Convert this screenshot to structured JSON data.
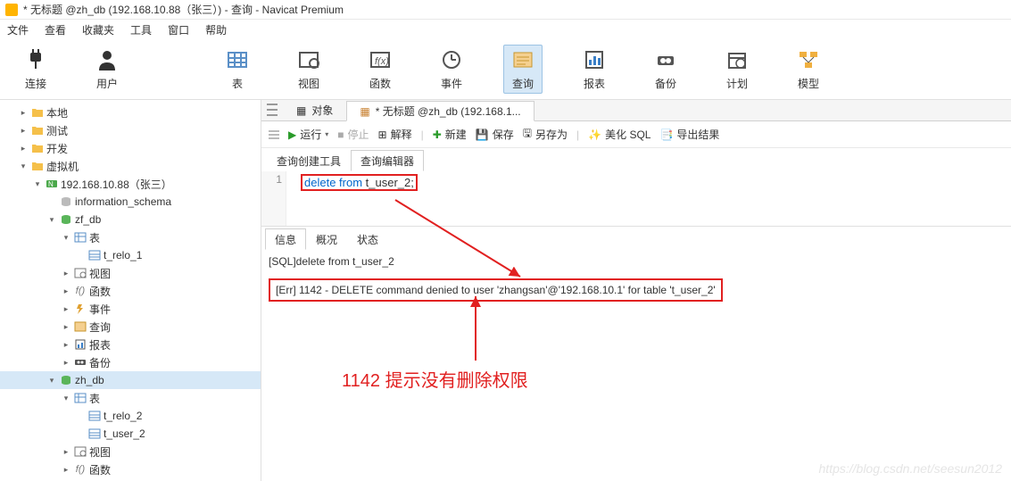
{
  "titlebar": {
    "text": "* 无标题 @zh_db (192.168.10.88（张三）) - 查询 - Navicat Premium"
  },
  "menubar": [
    "文件",
    "查看",
    "收藏夹",
    "工具",
    "窗口",
    "帮助"
  ],
  "toolbar": [
    {
      "label": "连接",
      "icon": "plug"
    },
    {
      "label": "用户",
      "icon": "user"
    },
    {
      "label": "表",
      "icon": "table"
    },
    {
      "label": "视图",
      "icon": "view"
    },
    {
      "label": "函数",
      "icon": "fx"
    },
    {
      "label": "事件",
      "icon": "event"
    },
    {
      "label": "查询",
      "icon": "query",
      "active": true
    },
    {
      "label": "报表",
      "icon": "report"
    },
    {
      "label": "备份",
      "icon": "backup"
    },
    {
      "label": "计划",
      "icon": "schedule"
    },
    {
      "label": "模型",
      "icon": "model"
    }
  ],
  "tree": [
    {
      "lvl": 0,
      "exp": ">",
      "icon": "folder",
      "label": "本地"
    },
    {
      "lvl": 0,
      "exp": ">",
      "icon": "folder",
      "label": "测试"
    },
    {
      "lvl": 0,
      "exp": ">",
      "icon": "folder",
      "label": "开发"
    },
    {
      "lvl": 0,
      "exp": "v",
      "icon": "folder",
      "label": "虚拟机"
    },
    {
      "lvl": 1,
      "exp": "v",
      "icon": "conn",
      "label": "192.168.10.88（张三）"
    },
    {
      "lvl": 2,
      "exp": "",
      "icon": "db-off",
      "label": "information_schema"
    },
    {
      "lvl": 2,
      "exp": "v",
      "icon": "db",
      "label": "zf_db"
    },
    {
      "lvl": 3,
      "exp": "v",
      "icon": "tables",
      "label": "表"
    },
    {
      "lvl": 4,
      "exp": "",
      "icon": "table",
      "label": "t_relo_1"
    },
    {
      "lvl": 3,
      "exp": ">",
      "icon": "view",
      "label": "视图"
    },
    {
      "lvl": 3,
      "exp": ">",
      "icon": "fx",
      "label": "函数"
    },
    {
      "lvl": 3,
      "exp": ">",
      "icon": "event",
      "label": "事件"
    },
    {
      "lvl": 3,
      "exp": ">",
      "icon": "query",
      "label": "查询"
    },
    {
      "lvl": 3,
      "exp": ">",
      "icon": "report",
      "label": "报表"
    },
    {
      "lvl": 3,
      "exp": ">",
      "icon": "backup",
      "label": "备份"
    },
    {
      "lvl": 2,
      "exp": "v",
      "icon": "db",
      "label": "zh_db",
      "selected": true
    },
    {
      "lvl": 3,
      "exp": "v",
      "icon": "tables",
      "label": "表"
    },
    {
      "lvl": 4,
      "exp": "",
      "icon": "table",
      "label": "t_relo_2"
    },
    {
      "lvl": 4,
      "exp": "",
      "icon": "table",
      "label": "t_user_2"
    },
    {
      "lvl": 3,
      "exp": ">",
      "icon": "view",
      "label": "视图"
    },
    {
      "lvl": 3,
      "exp": ">",
      "icon": "fx",
      "label": "函数"
    }
  ],
  "tabs": [
    {
      "label": "对象",
      "icon": "obj"
    },
    {
      "label": "* 无标题 @zh_db (192.168.1...",
      "icon": "query",
      "active": true
    }
  ],
  "actions": {
    "run": "运行",
    "stop": "停止",
    "explain": "解释",
    "new": "新建",
    "save": "保存",
    "saveas": "另存为",
    "beautify": "美化 SQL",
    "export": "导出结果"
  },
  "innertabs": [
    {
      "label": "查询创建工具"
    },
    {
      "label": "查询编辑器",
      "active": true
    }
  ],
  "editor": {
    "lineno": "1",
    "code_kw1": "delete",
    "code_kw2": "from",
    "code_rest": " t_user_2;"
  },
  "restabs": [
    {
      "label": "信息",
      "active": true
    },
    {
      "label": "概况"
    },
    {
      "label": "状态"
    }
  ],
  "results": {
    "line1": "[SQL]delete from t_user_2",
    "error": "[Err] 1142 - DELETE command denied to user 'zhangsan'@'192.168.10.1' for table 't_user_2'"
  },
  "annotation": "1142 提示没有删除权限",
  "watermark": "https://blog.csdn.net/seesun2012"
}
